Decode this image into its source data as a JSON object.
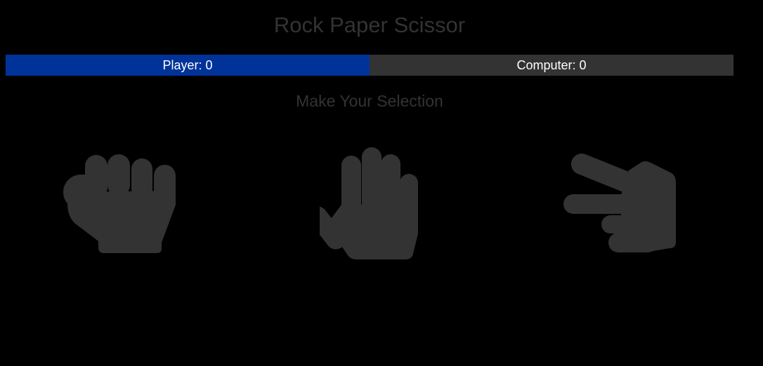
{
  "game": {
    "title": "Rock Paper Scissor",
    "subtitle": "Make Your Selection"
  },
  "scoreboard": {
    "player_label": "Player: 0",
    "computer_label": "Computer: 0",
    "player_color": "#003399",
    "computer_color": "#333333"
  },
  "choices": [
    {
      "name": "rock",
      "icon": "hand-rock-icon"
    },
    {
      "name": "paper",
      "icon": "hand-paper-icon"
    },
    {
      "name": "scissors",
      "icon": "hand-scissors-icon"
    }
  ],
  "colors": {
    "background": "#000000",
    "icon": "#333333",
    "text_muted": "#333333"
  }
}
